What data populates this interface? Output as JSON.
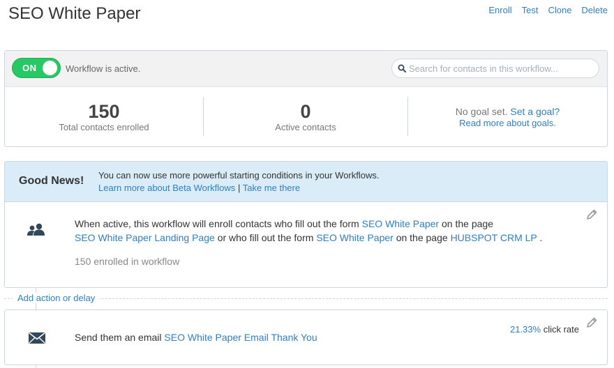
{
  "header": {
    "title": "SEO White Paper",
    "actions": [
      "Enroll",
      "Test",
      "Clone",
      "Delete"
    ]
  },
  "status": {
    "toggle_label": "ON",
    "toggle_on": true,
    "workflow_status": "Workflow is active.",
    "search_placeholder": "Search for contacts in this workflow..."
  },
  "stats": {
    "total_enrolled_value": "150",
    "total_enrolled_label": "Total contacts enrolled",
    "active_value": "0",
    "active_label": "Active contacts",
    "goal_text": "No goal set.",
    "goal_link": "Set a goal?",
    "goal_read_more": "Read more about goals."
  },
  "news": {
    "title": "Good News!",
    "message": "You can now use more powerful starting conditions in your Workflows.",
    "link_learn": "Learn more about Beta Workflows",
    "separator": "|",
    "link_take": "Take me there"
  },
  "trigger": {
    "text_1": "When active, this workflow will enroll contacts who fill out the form",
    "form_1": "SEO White Paper",
    "text_2": "on the page",
    "page_1": "SEO White Paper Landing Page",
    "text_3": "or who fill out the form",
    "form_2": "SEO White Paper",
    "text_4": "on the page",
    "page_2": "HUBSPOT CRM LP",
    "text_5": ".",
    "enrolled_note": "150 enrolled in workflow"
  },
  "add_action": {
    "label": "Add action or delay"
  },
  "email_step": {
    "text": "Send them an email",
    "email_name": "SEO White Paper Email Thank You",
    "click_rate_value": "21.33%",
    "click_rate_label": "click rate"
  },
  "colors": {
    "accent": "#2f7fc1",
    "toggle_on": "#27c964",
    "banner": "#d9ecf7",
    "border": "#cbd6e2"
  },
  "icons": {
    "search": "search-icon",
    "contacts": "contacts-icon",
    "edit": "pencil-icon",
    "email": "envelope-icon"
  }
}
